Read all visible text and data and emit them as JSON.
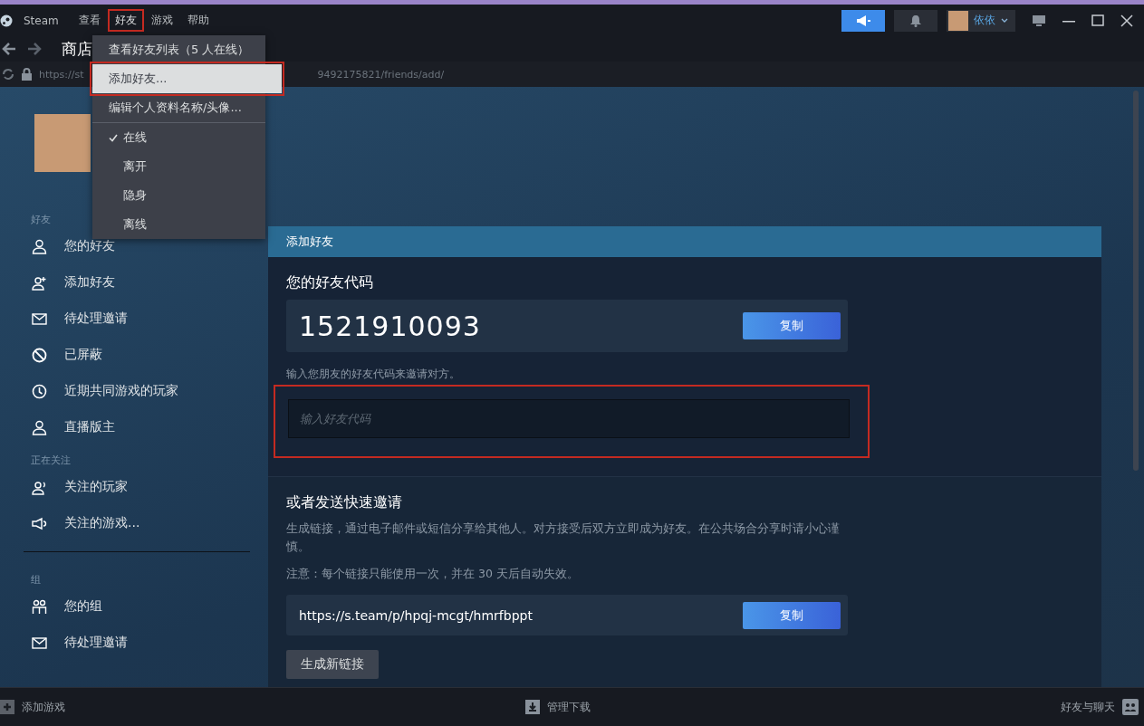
{
  "top_menu": [
    {
      "label": "Steam",
      "kind": "brand",
      "annotated": false
    },
    {
      "label": "查看",
      "kind": "menu",
      "annotated": false
    },
    {
      "label": "好友",
      "kind": "menu",
      "annotated": true
    },
    {
      "label": "游戏",
      "kind": "menu",
      "annotated": false
    },
    {
      "label": "帮助",
      "kind": "menu",
      "annotated": false
    }
  ],
  "account": {
    "name": "依依"
  },
  "nav": {
    "title": "商店",
    "url_start": "https://st",
    "url_end": "9492175821/friends/add/"
  },
  "dropdown": {
    "items": [
      {
        "label": "查看好友列表（5 人在线）",
        "kind": "action",
        "selected": false,
        "annotated": false
      },
      {
        "label": "添加好友...",
        "kind": "action",
        "selected": true,
        "annotated": true
      },
      {
        "label": "编辑个人资料名称/头像...",
        "kind": "action",
        "selected": false,
        "annotated": false
      },
      {
        "label": "在线",
        "kind": "status",
        "checked": true
      },
      {
        "label": "离开",
        "kind": "status",
        "checked": false
      },
      {
        "label": "隐身",
        "kind": "status",
        "checked": false
      },
      {
        "label": "离线",
        "kind": "status",
        "checked": false
      }
    ]
  },
  "sidebar": {
    "sections": [
      {
        "title": "好友",
        "divider": false,
        "items": [
          {
            "label": "您的好友",
            "kind": "person"
          },
          {
            "label": "添加好友",
            "kind": "person-add"
          },
          {
            "label": "待处理邀请",
            "kind": "mail"
          },
          {
            "label": "已屏蔽",
            "kind": "block"
          },
          {
            "label": "近期共同游戏的玩家",
            "kind": "clock"
          },
          {
            "label": "直播版主",
            "kind": "person"
          }
        ]
      },
      {
        "title": "正在关注",
        "divider": false,
        "items": [
          {
            "label": "关注的玩家",
            "kind": "person-follow"
          },
          {
            "label": "关注的游戏...",
            "kind": "megaphone"
          }
        ]
      },
      {
        "title": "组",
        "divider": true,
        "items": [
          {
            "label": "您的组",
            "kind": "group"
          },
          {
            "label": "待处理邀请",
            "kind": "mail"
          }
        ]
      }
    ]
  },
  "panel": {
    "title": "添加好友",
    "code_heading": "您的好友代码",
    "friend_code": "1521910093",
    "copy_button": "复制",
    "input_hint": "输入您朋友的好友代码来邀请对方。",
    "input": {
      "placeholder": "输入好友代码",
      "annotated": true
    },
    "invite_heading": "或者发送快速邀请",
    "invite_description": "生成链接，通过电子邮件或短信分享给其他人。对方接受后双方立即成为好友。在公共场合分享时请小心谨慎。",
    "invite_note": "注意：每个链接只能使用一次，并在 30 天后自动失效。",
    "invite_link": "https://s.team/p/hpqj-mcgt/hmrfbppt",
    "link_copy_button": "复制",
    "new_link_button": "生成新链接"
  },
  "bottom_bar": {
    "add_game": "添加游戏",
    "downloads": "管理下载",
    "friends_chat": "好友与聊天"
  }
}
